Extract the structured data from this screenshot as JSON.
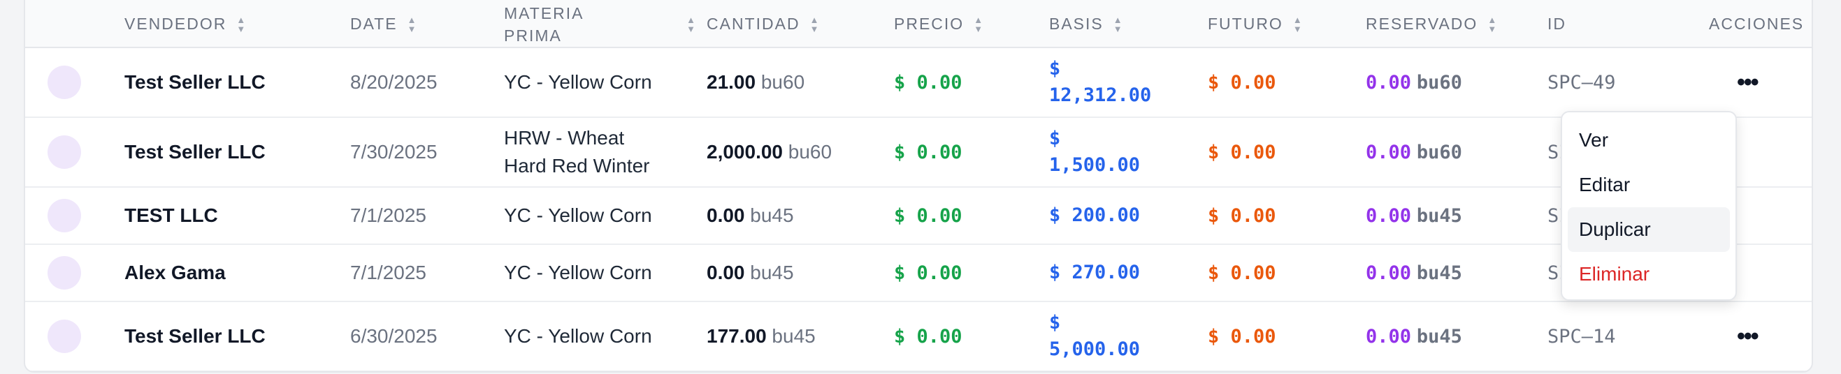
{
  "columns": {
    "vendor": "VENDEDOR",
    "date": "DATE",
    "material_1": "MATERIA",
    "material_2": "PRIMA",
    "quantity": "CANTIDAD",
    "price": "PRECIO",
    "basis": "BASIS",
    "futures": "FUTURO",
    "reserved": "RESERVADO",
    "id": "ID",
    "actions": "ACCIONES"
  },
  "rows": [
    {
      "vendor": "Test Seller LLC",
      "date": "8/20/2025",
      "material_1": "YC - Yellow Corn",
      "material_2": "",
      "qty": "21.00",
      "qty_unit": "bu60",
      "price": "$ 0.00",
      "basis_1": "$",
      "basis_2": "12,312.00",
      "futures": "$ 0.00",
      "reserved": "0.00",
      "reserved_unit": "bu60",
      "id": "SPC–49"
    },
    {
      "vendor": "Test Seller LLC",
      "date": "7/30/2025",
      "material_1": "HRW - Wheat",
      "material_2": "Hard Red Winter",
      "qty": "2,000.00",
      "qty_unit": "bu60",
      "price": "$ 0.00",
      "basis_1": "$",
      "basis_2": "1,500.00",
      "futures": "$ 0.00",
      "reserved": "0.00",
      "reserved_unit": "bu60",
      "id": "SI"
    },
    {
      "vendor": "TEST LLC",
      "date": "7/1/2025",
      "material_1": "YC - Yellow Corn",
      "material_2": "",
      "qty": "0.00",
      "qty_unit": "bu45",
      "price": "$ 0.00",
      "basis_1": "$ 200.00",
      "basis_2": "",
      "futures": "$ 0.00",
      "reserved": "0.00",
      "reserved_unit": "bu45",
      "id": "SI"
    },
    {
      "vendor": "Alex Gama",
      "date": "7/1/2025",
      "material_1": "YC - Yellow Corn",
      "material_2": "",
      "qty": "0.00",
      "qty_unit": "bu45",
      "price": "$ 0.00",
      "basis_1": "$ 270.00",
      "basis_2": "",
      "futures": "$ 0.00",
      "reserved": "0.00",
      "reserved_unit": "bu45",
      "id": "SI"
    },
    {
      "vendor": "Test Seller LLC",
      "date": "6/30/2025",
      "material_1": "YC - Yellow Corn",
      "material_2": "",
      "qty": "177.00",
      "qty_unit": "bu45",
      "price": "$ 0.00",
      "basis_1": "$",
      "basis_2": "5,000.00",
      "futures": "$ 0.00",
      "reserved": "0.00",
      "reserved_unit": "bu45",
      "id": "SPC–14"
    }
  ],
  "actions_icon": "more-horizontal-icon",
  "actions_glyph": "•••",
  "menu": {
    "view": "Ver",
    "edit": "Editar",
    "duplicate": "Duplicar",
    "delete": "Eliminar"
  },
  "colors": {
    "price": "#16a34a",
    "basis": "#2563eb",
    "futures": "#ea580c",
    "reserved": "#9333ea",
    "delete": "#dc2626"
  }
}
